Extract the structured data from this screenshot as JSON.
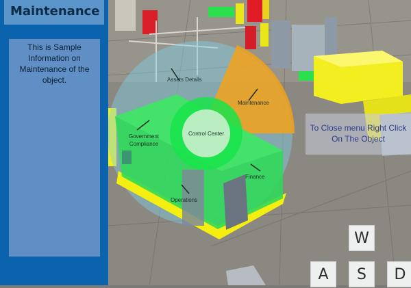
{
  "panel": {
    "title": "Maintenance",
    "body": "This is Sample Information on Maintenance of the object."
  },
  "radial_menu": {
    "center_label": "Control Center",
    "items": [
      {
        "label": "Assets Details"
      },
      {
        "label": "Maintenance",
        "highlighted": true
      },
      {
        "label": "Government Compliance"
      },
      {
        "label": "Finance"
      },
      {
        "label": "Operations"
      }
    ]
  },
  "hint": "To Close menu Right Click On The Object",
  "keys": {
    "w": "W",
    "a": "A",
    "s": "S",
    "d": "D"
  },
  "colors": {
    "panel_bg": "#0b62ad",
    "building": "#33dd55",
    "radial_highlight": "#f2a21a",
    "radial_ring": "#7fd0e6"
  }
}
